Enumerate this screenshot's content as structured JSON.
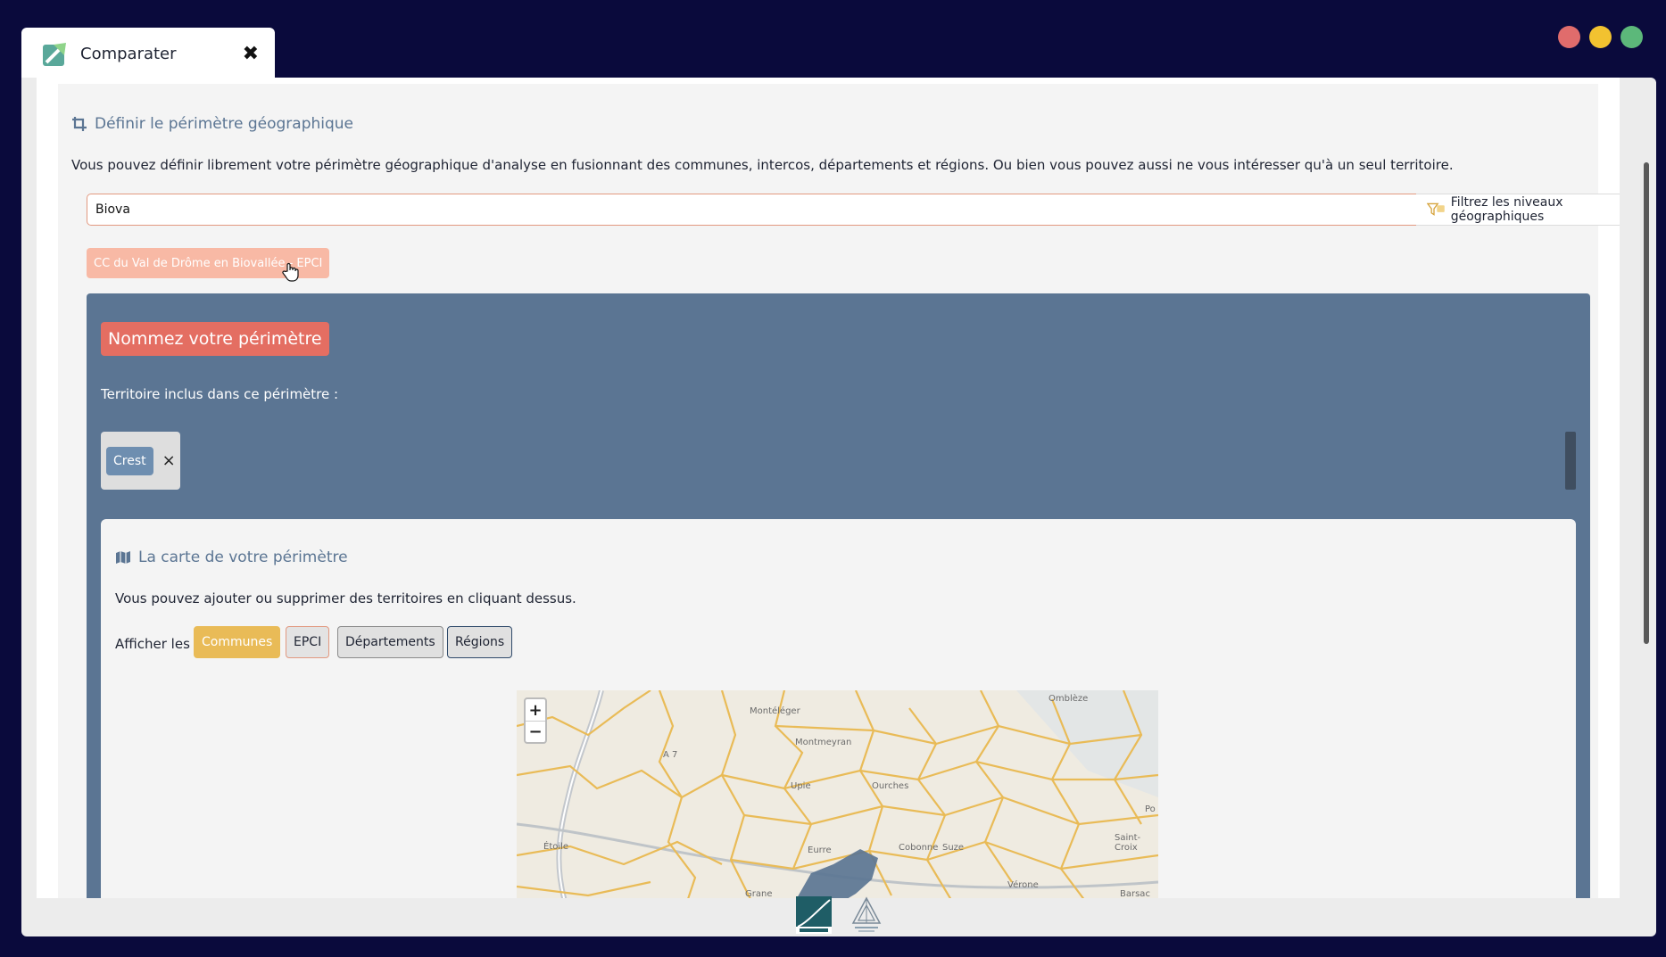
{
  "window": {
    "tab_title": "Comparater",
    "traffic_colors": [
      "#e06c6c",
      "#f2c230",
      "#5cb87a"
    ]
  },
  "perimetre": {
    "title": "Définir le périmètre géographique",
    "description": "Vous pouvez définir librement votre périmètre géographique d'analyse en fusionnant des communes, intercos, départements et régions. Ou bien vous pouvez aussi ne vous intéresser qu'à un seul territoire.",
    "search_value": "Biova",
    "filter_label": "Filtrez les niveaux géographiques",
    "suggestion": "CC du Val de Drôme en Biovallée - EPCI"
  },
  "panel": {
    "name_button": "Nommez votre périmètre",
    "included_label": "Territoire inclus dans ce périmètre :",
    "tags": [
      {
        "label": "Crest",
        "remove": "×"
      }
    ]
  },
  "map_section": {
    "title": "La carte de votre périmètre",
    "description": "Vous pouvez ajouter ou supprimer des territoires en cliquant dessus.",
    "show_label": "Afficher les",
    "layers": [
      "Communes",
      "EPCI",
      "Départements",
      "Régions"
    ],
    "active_layer": "Communes",
    "zoom_in": "+",
    "zoom_out": "−",
    "place_labels": [
      "Omblèze",
      "Montéléger",
      "Montmeyran",
      "A 7",
      "Upie",
      "Ourches",
      "Étoile",
      "Eurre",
      "Cobonne",
      "Suze",
      "Saint-Croix",
      "Vérone",
      "Grane",
      "Barsac",
      "Po"
    ]
  },
  "colors": {
    "accent_salmon": "#e46e62",
    "panel_blue": "#5b7593",
    "communes_gold": "#e9bb57",
    "selected_area": "#5b7593"
  }
}
